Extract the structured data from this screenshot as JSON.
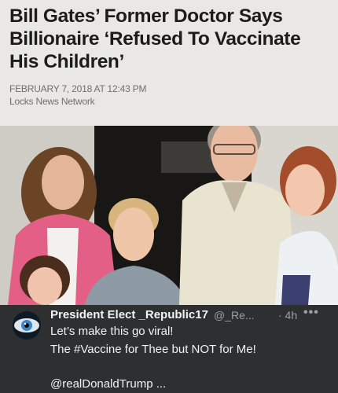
{
  "article": {
    "headline": "Bill Gates’ Former Doctor Says Billionaire ‘Refused To Vaccinate His Children’",
    "dateline": "FEBRUARY 7, 2018 AT 12:43 PM",
    "source": "Locks News Network"
  },
  "photo": {
    "description_icon": "family-photo"
  },
  "tweet": {
    "display_name": "President Elect _Republic17",
    "handle": "@_Re...",
    "time": "· 4h",
    "more": "•••",
    "line1": "Let’s make this go viral!",
    "line2": "The #Vaccine for Thee but NOT for Me!",
    "line3": "@realDonaldTrump ..."
  },
  "colors": {
    "tweet_bg": "#2d2f31",
    "headline": "#1c1c1c",
    "meta": "#6f6f6f"
  }
}
